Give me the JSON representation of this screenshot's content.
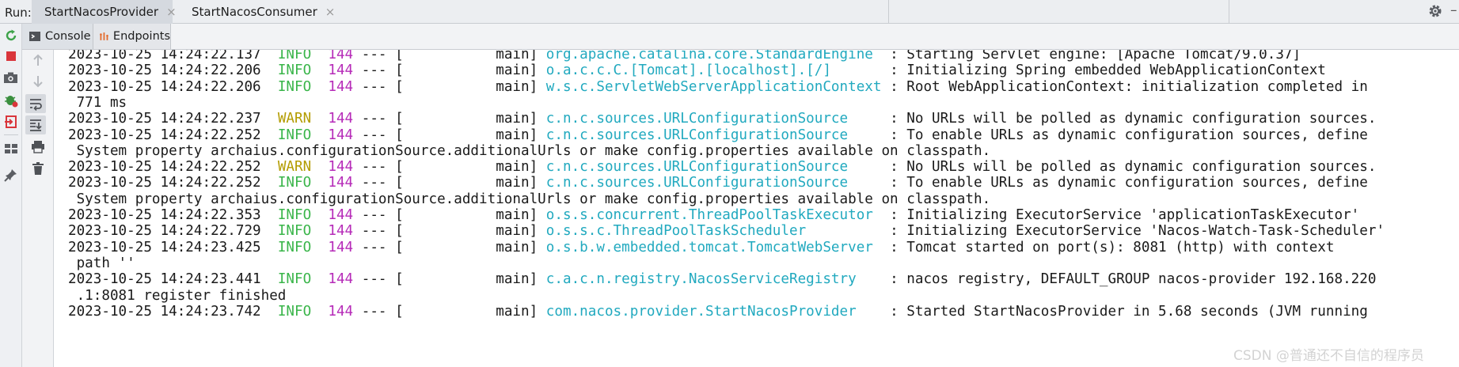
{
  "run_bar": {
    "label": "Run:",
    "tabs": [
      {
        "label": "StartNacosProvider",
        "close": "×",
        "active": true
      },
      {
        "label": "StartNacosConsumer",
        "close": "×",
        "active": false
      }
    ],
    "minimize": "–"
  },
  "sub_tabs": [
    {
      "label": "Console"
    },
    {
      "label": "Endpoints"
    }
  ],
  "colors": {
    "info": "#3ab54a",
    "warn": "#b39c00",
    "pid": "#b62bb8",
    "logger": "#21a9bf"
  },
  "console": {
    "lines": [
      {
        "ts": "2023-10-25 14:24:22.137",
        "level": "INFO",
        "pid": "144",
        "sep": " --- [",
        "thread": "           main] ",
        "logger": "org.apache.catalina.core.StandardEngine ",
        "msg": " : Starting Servlet engine: [Apache Tomcat/9.0.37]"
      },
      {
        "ts": "2023-10-25 14:24:22.206",
        "level": "INFO",
        "pid": "144",
        "sep": " --- [",
        "thread": "           main] ",
        "logger": "o.a.c.c.C.[Tomcat].[localhost].[/]      ",
        "msg": " : Initializing Spring embedded WebApplicationContext"
      },
      {
        "ts": "2023-10-25 14:24:22.206",
        "level": "INFO",
        "pid": "144",
        "sep": " --- [",
        "thread": "           main] ",
        "logger": "w.s.c.ServletWebServerApplicationContext",
        "msg": " : Root WebApplicationContext: initialization completed in"
      },
      {
        "cont": " 771 ms"
      },
      {
        "ts": "2023-10-25 14:24:22.237",
        "level": "WARN",
        "pid": "144",
        "sep": " --- [",
        "thread": "           main] ",
        "logger": "c.n.c.sources.URLConfigurationSource    ",
        "msg": " : No URLs will be polled as dynamic configuration sources."
      },
      {
        "ts": "2023-10-25 14:24:22.252",
        "level": "INFO",
        "pid": "144",
        "sep": " --- [",
        "thread": "           main] ",
        "logger": "c.n.c.sources.URLConfigurationSource    ",
        "msg": " : To enable URLs as dynamic configuration sources, define"
      },
      {
        "cont": " System property archaius.configurationSource.additionalUrls or make config.properties available on classpath."
      },
      {
        "ts": "2023-10-25 14:24:22.252",
        "level": "WARN",
        "pid": "144",
        "sep": " --- [",
        "thread": "           main] ",
        "logger": "c.n.c.sources.URLConfigurationSource    ",
        "msg": " : No URLs will be polled as dynamic configuration sources."
      },
      {
        "ts": "2023-10-25 14:24:22.252",
        "level": "INFO",
        "pid": "144",
        "sep": " --- [",
        "thread": "           main] ",
        "logger": "c.n.c.sources.URLConfigurationSource    ",
        "msg": " : To enable URLs as dynamic configuration sources, define"
      },
      {
        "cont": " System property archaius.configurationSource.additionalUrls or make config.properties available on classpath."
      },
      {
        "ts": "2023-10-25 14:24:22.353",
        "level": "INFO",
        "pid": "144",
        "sep": " --- [",
        "thread": "           main] ",
        "logger": "o.s.s.concurrent.ThreadPoolTaskExecutor ",
        "msg": " : Initializing ExecutorService 'applicationTaskExecutor'"
      },
      {
        "ts": "2023-10-25 14:24:22.729",
        "level": "INFO",
        "pid": "144",
        "sep": " --- [",
        "thread": "           main] ",
        "logger": "o.s.s.c.ThreadPoolTaskScheduler         ",
        "msg": " : Initializing ExecutorService 'Nacos-Watch-Task-Scheduler'"
      },
      {
        "ts": "2023-10-25 14:24:23.425",
        "level": "INFO",
        "pid": "144",
        "sep": " --- [",
        "thread": "           main] ",
        "logger": "o.s.b.w.embedded.tomcat.TomcatWebServer ",
        "msg": " : Tomcat started on port(s): 8081 (http) with context"
      },
      {
        "cont": " path ''"
      },
      {
        "ts": "2023-10-25 14:24:23.441",
        "level": "INFO",
        "pid": "144",
        "sep": " --- [",
        "thread": "           main] ",
        "logger": "c.a.c.n.registry.NacosServiceRegistry   ",
        "msg": " : nacos registry, DEFAULT_GROUP nacos-provider 192.168.220"
      },
      {
        "cont": " .1:8081 register finished"
      },
      {
        "ts": "2023-10-25 14:24:23.742",
        "level": "INFO",
        "pid": "144",
        "sep": " --- [",
        "thread": "           main] ",
        "logger": "com.nacos.provider.StartNacosProvider   ",
        "msg": " : Started StartNacosProvider in 5.68 seconds (JVM running"
      }
    ]
  },
  "watermark": "CSDN @普通还不自信的程序员",
  "icons": {
    "left_toolbar": [
      "rerun-icon",
      "stop-icon",
      "camera-icon",
      "debug-icon",
      "exit-icon",
      "layout-icon",
      "pin-icon"
    ],
    "console_toolbar": [
      "up-arrow-icon",
      "down-arrow-icon",
      "soft-wrap-icon",
      "scroll-to-end-icon",
      "print-icon",
      "trash-icon"
    ]
  }
}
